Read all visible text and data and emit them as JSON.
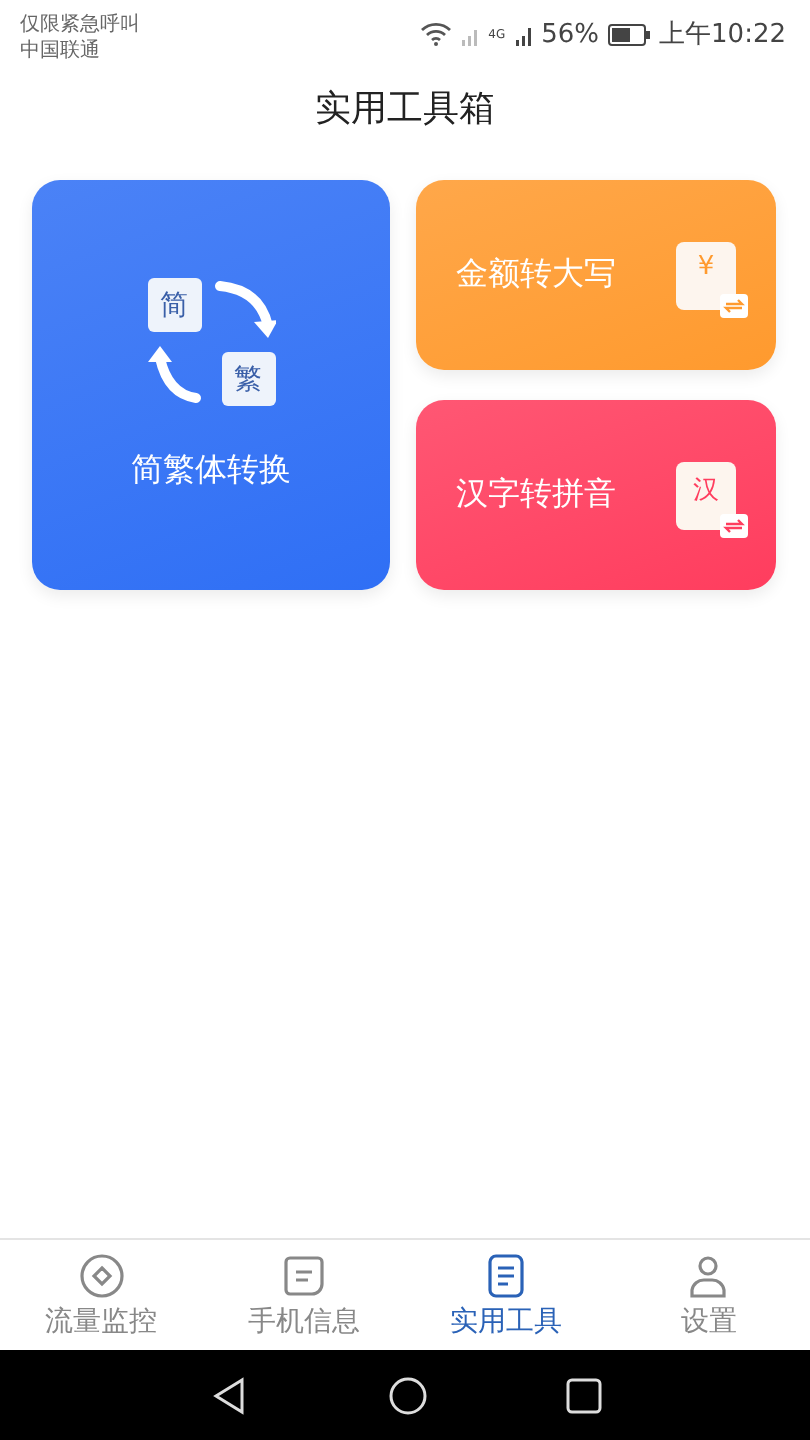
{
  "status_bar": {
    "carrier_lines": [
      "仅限紧急呼叫",
      "中国联通"
    ],
    "battery_text": "56%",
    "time": "上午10:22",
    "network": "4G"
  },
  "header": {
    "title": "实用工具箱"
  },
  "tools": [
    {
      "kind": "large",
      "label": "简繁体转换",
      "color": "#2f6ff5",
      "icon_chars": [
        "简",
        "繁"
      ]
    },
    {
      "kind": "small",
      "label": "金额转大写",
      "color": "#ff9a2e",
      "icon_chars": [
        "¥"
      ]
    },
    {
      "kind": "small",
      "label": "汉字转拼音",
      "color": "#ff3d5e",
      "icon_chars": [
        "汉"
      ]
    }
  ],
  "tabs": [
    {
      "label": "流量监控",
      "kind": "diamond",
      "selected": false
    },
    {
      "label": "手机信息",
      "kind": "message",
      "selected": false
    },
    {
      "label": "实用工具",
      "kind": "document",
      "selected": true
    },
    {
      "label": "设置",
      "kind": "person",
      "selected": false
    }
  ]
}
